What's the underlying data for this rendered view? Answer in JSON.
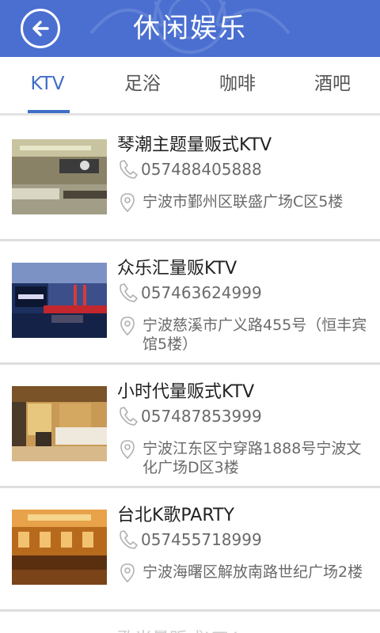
{
  "header": {
    "title": "休闲娱乐"
  },
  "tabs": [
    {
      "label": "KTV"
    },
    {
      "label": "足浴"
    },
    {
      "label": "咖啡"
    },
    {
      "label": "酒吧"
    }
  ],
  "items": [
    {
      "name": "琴潮主题量贩式KTV",
      "phone": "057488405888",
      "address": "宁波市鄞州区联盛广场C区5楼"
    },
    {
      "name": "众乐汇量贩KTV",
      "phone": "057463624999",
      "address": "宁波慈溪市广义路455号（恒丰宾馆5楼）"
    },
    {
      "name": "小时代量贩式KTV",
      "phone": "057487853999",
      "address": "宁波江东区宁穿路1888号宁波文化广场D区3楼"
    },
    {
      "name": "台北K歌PARTY",
      "phone": "057455718999",
      "address": "宁波海曙区解放南路世纪广场2楼"
    }
  ],
  "partial_item": {
    "name": "歌光量贩式KTV"
  },
  "colors": {
    "header": "#4a6fd0",
    "accent": "#3f6ec6"
  }
}
